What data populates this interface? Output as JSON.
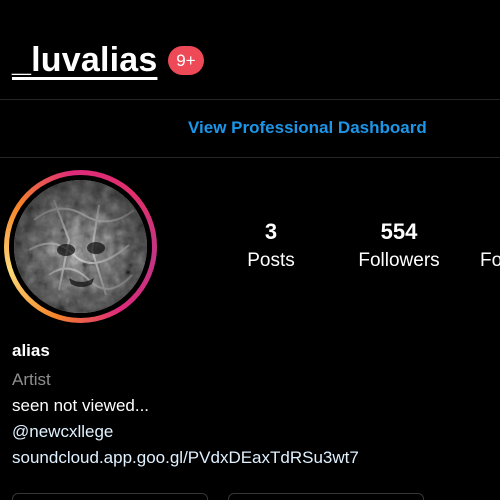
{
  "header": {
    "username": "_luvalias",
    "notification_badge": "9+"
  },
  "dashboard": {
    "link_label": "View Professional Dashboard"
  },
  "profile": {
    "avatar_icon": "profile-picture",
    "stats": {
      "posts": {
        "count": "3",
        "label": "Posts"
      },
      "followers": {
        "count": "554",
        "label": "Followers"
      },
      "following": {
        "count": "",
        "label": "Fo"
      }
    },
    "bio": {
      "name": "alias",
      "category": "Artist",
      "text": "seen not viewed...",
      "mention": "@newcxllege",
      "link": "soundcloud.app.goo.gl/PVdxDEaxTdRSu3wt7"
    }
  },
  "colors": {
    "background": "#000000",
    "badge": "#ed4956",
    "link_blue": "#1c96e8",
    "secondary_text": "#8e8e8e",
    "divider": "#262626"
  }
}
